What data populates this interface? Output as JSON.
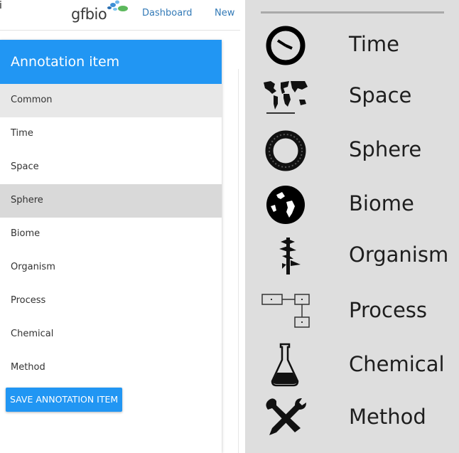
{
  "topbar": {
    "stray_char": "i",
    "logo_text": "gfbio",
    "nav": [
      {
        "label": "Dashboard"
      },
      {
        "label": "New"
      }
    ]
  },
  "panel": {
    "title": "Annotation item",
    "items": [
      {
        "label": "Common"
      },
      {
        "label": "Time"
      },
      {
        "label": "Space"
      },
      {
        "label": "Sphere"
      },
      {
        "label": "Biome"
      },
      {
        "label": "Organism"
      },
      {
        "label": "Process"
      },
      {
        "label": "Chemical"
      },
      {
        "label": "Method"
      }
    ],
    "save_label": "SAVE ANNOTATION ITEM"
  },
  "legend": {
    "items": [
      {
        "icon": "clock-icon",
        "label": "Time"
      },
      {
        "icon": "world-map-icon",
        "label": "Space"
      },
      {
        "icon": "ring-icon",
        "label": "Sphere"
      },
      {
        "icon": "globe-icon",
        "label": "Biome"
      },
      {
        "icon": "tree-icon",
        "label": "Organism"
      },
      {
        "icon": "flow-diagram-icon",
        "label": "Process"
      },
      {
        "icon": "flask-icon",
        "label": "Chemical"
      },
      {
        "icon": "tools-icon",
        "label": "Method"
      }
    ]
  },
  "colors": {
    "accent": "#2196f3",
    "link": "#337ab7",
    "selected_row": "#d9d9d9",
    "legend_bg": "#dedede"
  }
}
